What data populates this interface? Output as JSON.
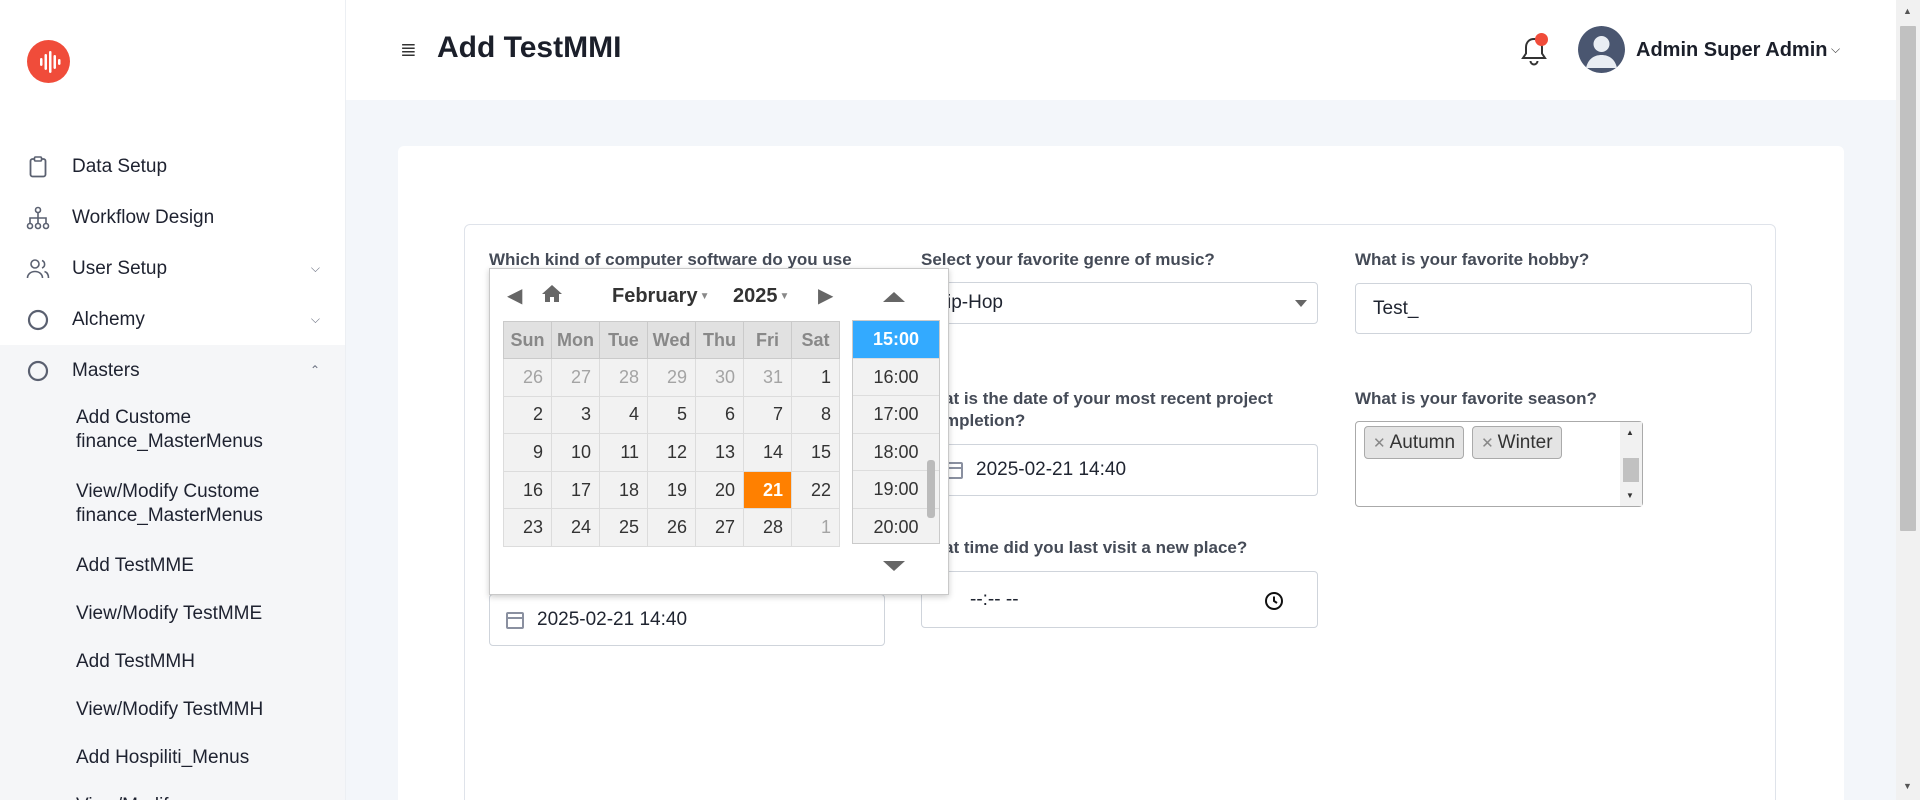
{
  "header": {
    "page_title": "Add TestMMI",
    "user_name": "Admin Super Admin"
  },
  "sidebar": {
    "items": [
      {
        "label": "Data Setup",
        "icon": "clipboard-icon"
      },
      {
        "label": "Workflow Design",
        "icon": "hierarchy-icon"
      },
      {
        "label": "User Setup",
        "icon": "users-icon",
        "chevron": "down"
      },
      {
        "label": "Alchemy",
        "icon": "circle-icon",
        "chevron": "down"
      },
      {
        "label": "Masters",
        "icon": "circle-icon",
        "chevron": "up"
      }
    ],
    "submenu": [
      "Add Custome finance_MasterMenus",
      "View/Modify Custome finance_MasterMenus",
      "Add TestMME",
      "View/Modify TestMME",
      "Add TestMMH",
      "View/Modify TestMMH",
      "Add Hospiliti_Menus",
      "View/Modify"
    ]
  },
  "form": {
    "q1_label": "Which kind of computer software do you use",
    "q1_value": "2025-02-21 14:40",
    "q2_label": "Select your favorite genre of music?",
    "q2_value": "ip-Hop",
    "q3_label": "What is your favorite hobby?",
    "q3_value": "Test_",
    "q4_label": "at is the date of your most recent project mpletion?",
    "q4_value": "2025-02-21 14:40",
    "q5_label": "What is your favorite season?",
    "q5_tags": [
      "Autumn",
      "Winter"
    ],
    "q6_label": "at time did you last visit a new place?",
    "q6_value": "--:-- --"
  },
  "datepicker": {
    "month": "February",
    "year": "2025",
    "weekdays": [
      "Sun",
      "Mon",
      "Tue",
      "Wed",
      "Thu",
      "Fri",
      "Sat"
    ],
    "weeks": [
      [
        {
          "d": "26",
          "o": true
        },
        {
          "d": "27",
          "o": true
        },
        {
          "d": "28",
          "o": true
        },
        {
          "d": "29",
          "o": true
        },
        {
          "d": "30",
          "o": true
        },
        {
          "d": "31",
          "o": true
        },
        {
          "d": "1"
        }
      ],
      [
        {
          "d": "2"
        },
        {
          "d": "3"
        },
        {
          "d": "4"
        },
        {
          "d": "5"
        },
        {
          "d": "6"
        },
        {
          "d": "7"
        },
        {
          "d": "8"
        }
      ],
      [
        {
          "d": "9"
        },
        {
          "d": "10"
        },
        {
          "d": "11"
        },
        {
          "d": "12"
        },
        {
          "d": "13"
        },
        {
          "d": "14"
        },
        {
          "d": "15"
        }
      ],
      [
        {
          "d": "16"
        },
        {
          "d": "17"
        },
        {
          "d": "18"
        },
        {
          "d": "19"
        },
        {
          "d": "20"
        },
        {
          "d": "21",
          "s": true
        },
        {
          "d": "22"
        }
      ],
      [
        {
          "d": "23"
        },
        {
          "d": "24"
        },
        {
          "d": "25"
        },
        {
          "d": "26"
        },
        {
          "d": "27"
        },
        {
          "d": "28"
        },
        {
          "d": "1",
          "o": true
        }
      ]
    ],
    "times": [
      "15:00",
      "16:00",
      "17:00",
      "18:00",
      "19:00",
      "20:00"
    ],
    "selected_time": "15:00"
  },
  "colors": {
    "brand": "#f04c3a",
    "selected_day": "#ff8000",
    "selected_time": "#33aaff"
  }
}
